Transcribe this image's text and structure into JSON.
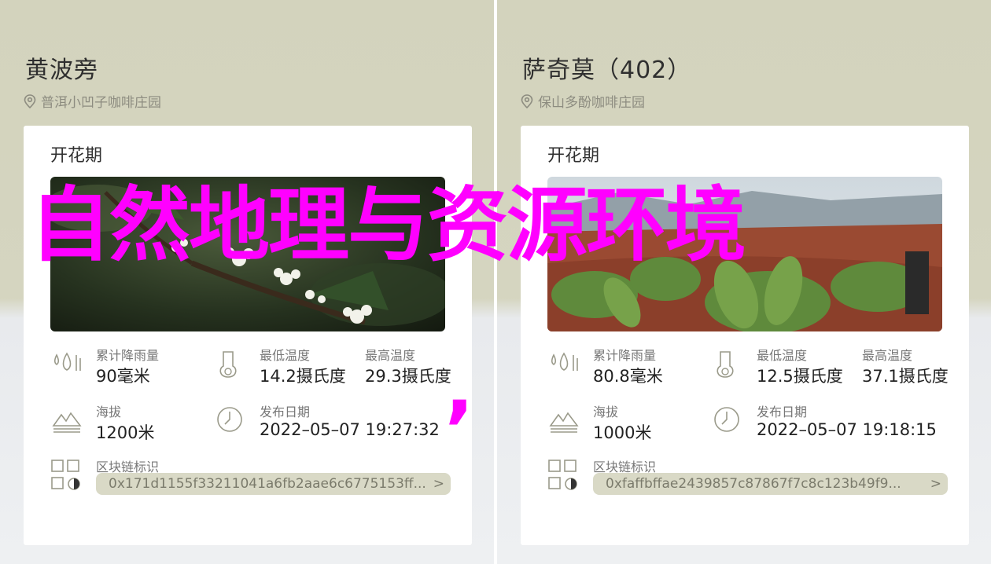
{
  "overlay": {
    "text": "自然地理与资源环境",
    "comma": ","
  },
  "colors": {
    "overlay": "#ff00ff",
    "pill_bg": "#d9d9c6",
    "header_bg": "#d3d3bd"
  },
  "cards": [
    {
      "farm_name": "黄波旁",
      "location": "普洱小凹子咖啡庄园",
      "section_title": "开花期",
      "photo_subject": "white coffee blossoms",
      "rainfall_label": "累计降雨量",
      "rainfall_value": "90毫米",
      "min_temp_label": "最低温度",
      "min_temp_value": "14.2摄氏度",
      "max_temp_label": "最高温度",
      "max_temp_value": "29.3摄氏度",
      "altitude_label": "海拔",
      "altitude_value": "1200米",
      "date_label": "发布日期",
      "date_value": "2022–05–07 19:27:32",
      "chain_label": "区块链标识",
      "chain_value": "0x171d1155f33211041a6fb2aae6c6775153ff...",
      "chain_arrow": ">"
    },
    {
      "farm_name": "萨奇莫（402）",
      "location": "保山多酚咖啡庄园",
      "section_title": "开花期",
      "photo_subject": "coffee plants on hillside",
      "rainfall_label": "累计降雨量",
      "rainfall_value": "80.8毫米",
      "min_temp_label": "最低温度",
      "min_temp_value": "12.5摄氏度",
      "max_temp_label": "最高温度",
      "max_temp_value": "37.1摄氏度",
      "altitude_label": "海拔",
      "altitude_value": "1000米",
      "date_label": "发布日期",
      "date_value": "2022–05–07 19:18:15",
      "chain_label": "区块链标识",
      "chain_value": "0xfaffbffae2439857c87867f7c8c123b49f9...",
      "chain_arrow": ">"
    }
  ]
}
